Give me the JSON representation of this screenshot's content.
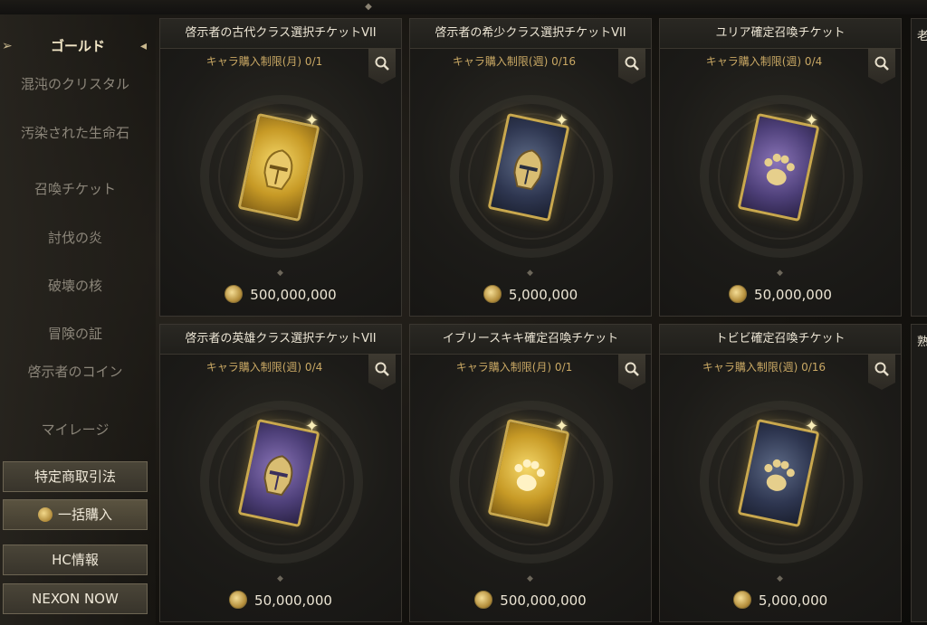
{
  "sidebar": {
    "selected": "ゴールド",
    "items": [
      "混沌のクリスタル",
      "汚染された生命石",
      "召喚チケット",
      "討伐の炎",
      "破壊の核",
      "冒険の証",
      "啓示者のコイン",
      "マイレージ"
    ],
    "buttons": {
      "special_trade": "特定商取引法",
      "bulk_buy": "一括購入",
      "hc_info": "HC情報",
      "nexon_now": "NEXON NOW"
    }
  },
  "items": [
    {
      "name": "啓示者の古代クラス選択チケットVII",
      "limit": "キャラ購入制限(月) 0/1",
      "price": "500,000,000",
      "color": "#c79a26",
      "icon": "helmet-icon"
    },
    {
      "name": "啓示者の希少クラス選択チケットVII",
      "limit": "キャラ購入制限(週) 0/16",
      "price": "5,000,000",
      "color": "#2e3650",
      "icon": "helmet-icon"
    },
    {
      "name": "ユリア確定召喚チケット",
      "limit": "キャラ購入制限(週) 0/4",
      "price": "50,000,000",
      "color": "#4d3f78",
      "icon": "paw-icon"
    },
    {
      "name": "啓示者の英雄クラス選択チケットVII",
      "limit": "キャラ購入制限(週) 0/4",
      "price": "50,000,000",
      "color": "#4d3f78",
      "icon": "helmet-icon"
    },
    {
      "name": "イブリースキキ確定召喚チケット",
      "limit": "キャラ購入制限(月) 0/1",
      "price": "500,000,000",
      "color": "#c79a26",
      "icon": "paw-icon"
    },
    {
      "name": "トビビ確定召喚チケット",
      "limit": "キャラ購入制限(週) 0/16",
      "price": "5,000,000",
      "color": "#2e3650",
      "icon": "paw-icon"
    }
  ],
  "edge": {
    "top_title": "老",
    "bottom_title": "熟"
  }
}
